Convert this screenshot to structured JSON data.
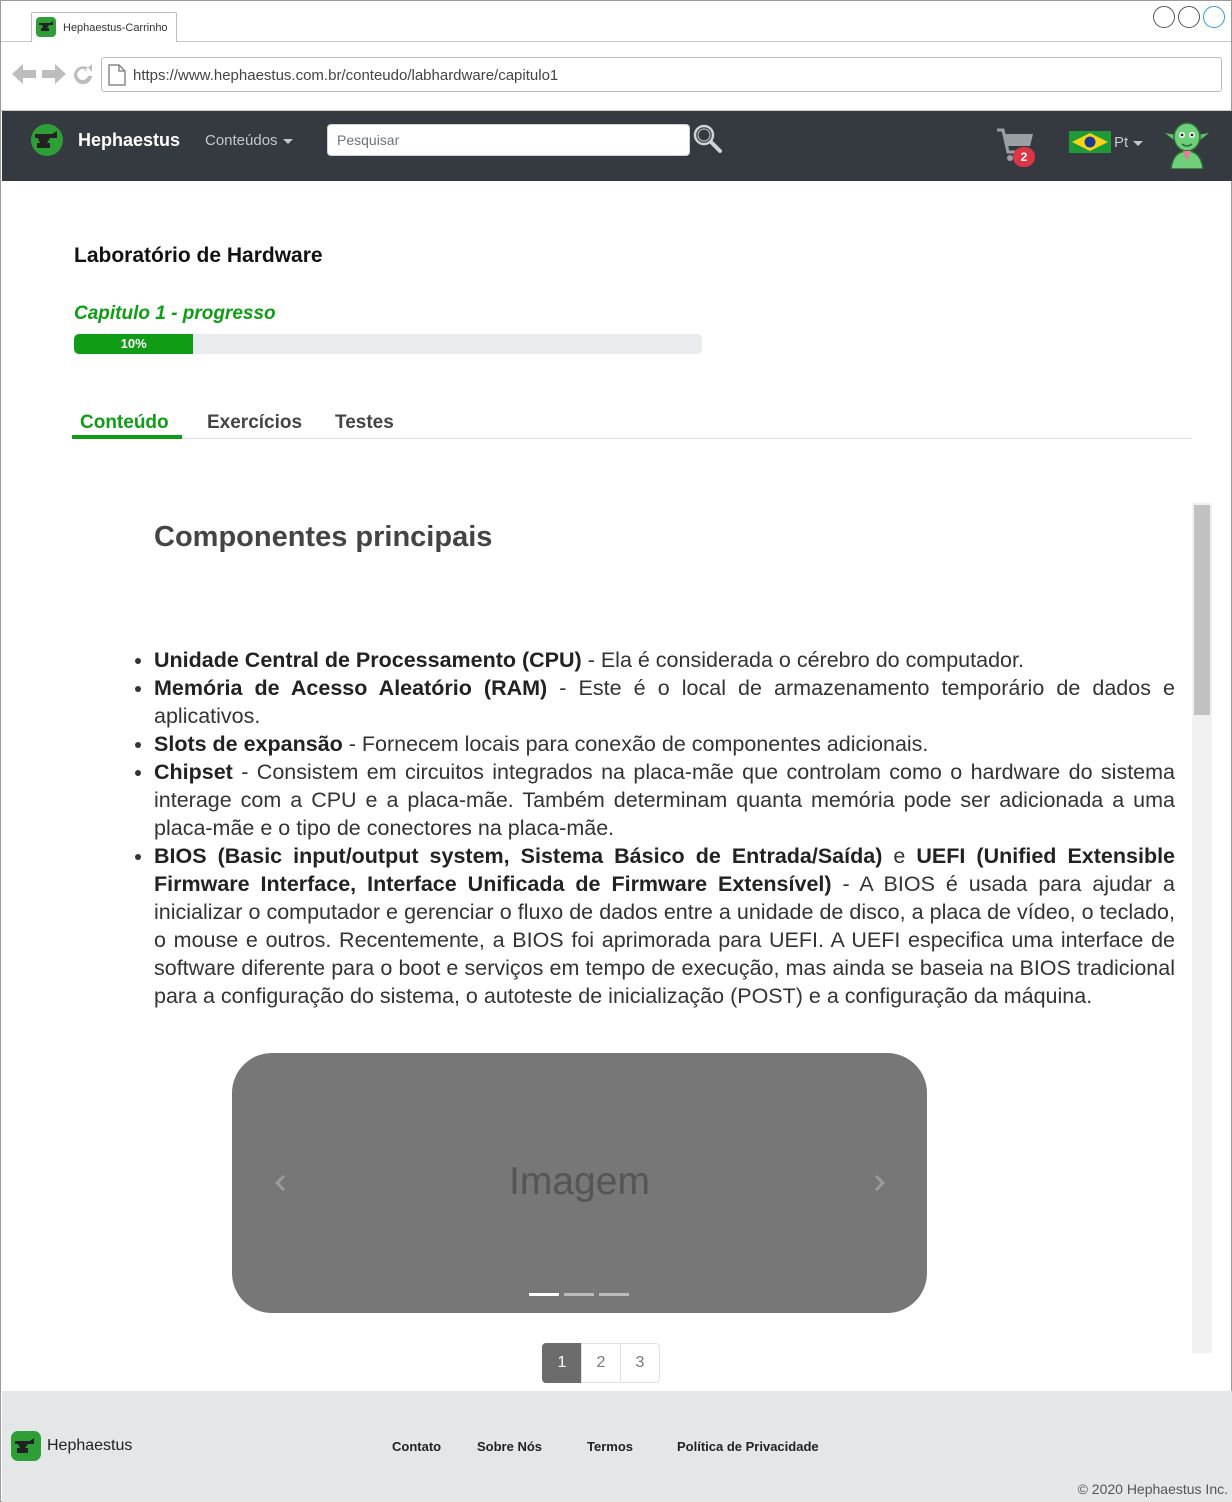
{
  "browser": {
    "tab_title": "Hephaestus-Carrinho",
    "url": "https://www.hephaestus.com.br/conteudo/labhardware/capitulo1"
  },
  "navbar": {
    "brand": "Hephaestus",
    "menu_label": "Conteúdos",
    "search_placeholder": "Pesquisar",
    "cart_count": "2",
    "language": "Pt"
  },
  "page": {
    "title": "Laboratório de Hardware",
    "progress_label": "Capitulo 1 - progresso",
    "progress_text": "10%",
    "progress_value": 0.19,
    "tabs": [
      "Conteúdo",
      "Exercícios",
      "Testes"
    ],
    "active_tab": "Conteúdo"
  },
  "content": {
    "heading": "Componentes principais",
    "items": [
      {
        "term": "Unidade Central de Processamento (CPU)",
        "text": " - Ela é considerada o cérebro do computador."
      },
      {
        "term": "Memória de Acesso Aleatório (RAM)",
        "text": " - Este é o local de armazenamento temporário de dados e aplicativos."
      },
      {
        "term": "Slots de expansão",
        "text": " - Fornecem locais para conexão de componentes adicionais."
      },
      {
        "term": "Chipset",
        "text": " - Consistem em circuitos integrados na placa-mãe que controlam como o hardware do sistema interage com a CPU e a placa-mãe. Também determinam quanta memória pode ser adicionada a uma placa-mãe e o tipo de conectores na placa-mãe."
      },
      {
        "term": "BIOS (Basic input/output system, Sistema Básico de Entrada/Saída)",
        "mid": " e ",
        "term2": "UEFI (Unified Extensible Firmware Interface, Interface Unificada de Firmware Extensível)",
        "text": " - A BIOS é usada para ajudar a inicializar o computador e gerenciar o fluxo de dados entre a unidade de disco, a placa de vídeo, o teclado, o mouse e outros. Recentemente, a BIOS foi aprimorada para UEFI. A UEFI especifica uma interface de software diferente para o boot e serviços em tempo de execução, mas ainda se baseia na BIOS tradicional para a configuração do sistema, o autoteste de inicialização (POST) e a configuração da máquina."
      }
    ],
    "carousel_text": "Imagem",
    "carousel_slides": 3,
    "pages": [
      "1",
      "2",
      "3"
    ],
    "current_page": "1"
  },
  "footer": {
    "brand": "Hephaestus",
    "links": [
      "Contato",
      "Sobre Nós",
      "Termos",
      "Política de Privacidade"
    ],
    "copyright": "© 2020 Hephaestus Inc."
  },
  "colors": {
    "accent": "#0f9d16",
    "navbar_bg": "#343a40",
    "badge": "#dc3545"
  },
  "icons": [
    "back-arrow-icon",
    "forward-arrow-icon",
    "reload-icon",
    "page-icon",
    "search-icon",
    "cart-icon",
    "brazil-flag-icon",
    "goblin-avatar-icon",
    "anvil-logo-icon",
    "chevron-left-icon",
    "chevron-right-icon"
  ]
}
